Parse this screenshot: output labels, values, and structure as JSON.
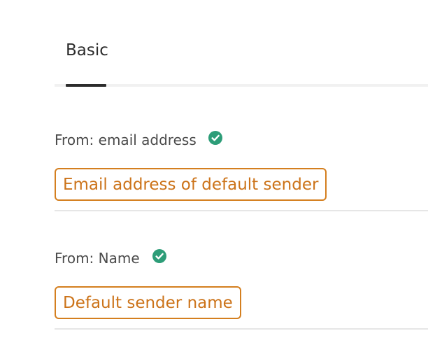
{
  "tabs": [
    {
      "label": "Basic",
      "selected": true
    }
  ],
  "fields": [
    {
      "label": "From: email address",
      "status": "valid",
      "status_icon": "check-circle-icon",
      "token_text": "Email address of default sender"
    },
    {
      "label": "From: Name",
      "status": "valid",
      "status_icon": "check-circle-icon",
      "token_text": "Default sender name"
    }
  ],
  "colors": {
    "token_border": "#d47f1f",
    "token_text": "#cc7319",
    "check_fill": "#2d9d78",
    "tab_indicator": "#2c2c2c"
  }
}
